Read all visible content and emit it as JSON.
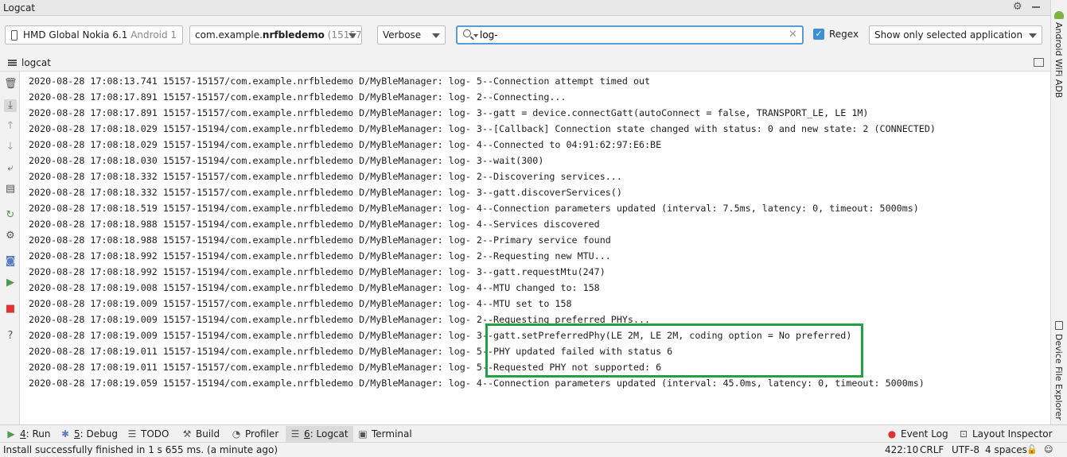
{
  "window": {
    "title": "Logcat"
  },
  "toolbar": {
    "device": {
      "name": "HMD Global Nokia 6.1",
      "os": "Android 1"
    },
    "process": {
      "package_prefix": "com.example.",
      "package_bold": "nrfbledemo",
      "pid": "(15157)"
    },
    "log_level": "Verbose",
    "search": {
      "value": "log-"
    },
    "regex": {
      "label": "Regex",
      "checked": true
    },
    "filter": "Show only selected application"
  },
  "tab": {
    "label": "logcat"
  },
  "log_lines": [
    "2020-08-28 17:08:13.741 15157-15157/com.example.nrfbledemo D/MyBleManager: log- 5--Connection attempt timed out",
    "2020-08-28 17:08:17.891 15157-15157/com.example.nrfbledemo D/MyBleManager: log- 2--Connecting...",
    "2020-08-28 17:08:17.891 15157-15157/com.example.nrfbledemo D/MyBleManager: log- 3--gatt = device.connectGatt(autoConnect = false, TRANSPORT_LE, LE 1M)",
    "2020-08-28 17:08:18.029 15157-15194/com.example.nrfbledemo D/MyBleManager: log- 3--[Callback] Connection state changed with status: 0 and new state: 2 (CONNECTED)",
    "2020-08-28 17:08:18.029 15157-15194/com.example.nrfbledemo D/MyBleManager: log- 4--Connected to 04:91:62:97:E6:BE",
    "2020-08-28 17:08:18.030 15157-15194/com.example.nrfbledemo D/MyBleManager: log- 3--wait(300)",
    "2020-08-28 17:08:18.332 15157-15157/com.example.nrfbledemo D/MyBleManager: log- 2--Discovering services...",
    "2020-08-28 17:08:18.332 15157-15157/com.example.nrfbledemo D/MyBleManager: log- 3--gatt.discoverServices()",
    "2020-08-28 17:08:18.519 15157-15194/com.example.nrfbledemo D/MyBleManager: log- 4--Connection parameters updated (interval: 7.5ms, latency: 0, timeout: 5000ms)",
    "2020-08-28 17:08:18.988 15157-15194/com.example.nrfbledemo D/MyBleManager: log- 4--Services discovered",
    "2020-08-28 17:08:18.988 15157-15194/com.example.nrfbledemo D/MyBleManager: log- 2--Primary service found",
    "2020-08-28 17:08:18.992 15157-15194/com.example.nrfbledemo D/MyBleManager: log- 2--Requesting new MTU...",
    "2020-08-28 17:08:18.992 15157-15194/com.example.nrfbledemo D/MyBleManager: log- 3--gatt.requestMtu(247)",
    "2020-08-28 17:08:19.008 15157-15194/com.example.nrfbledemo D/MyBleManager: log- 4--MTU changed to: 158",
    "2020-08-28 17:08:19.009 15157-15157/com.example.nrfbledemo D/MyBleManager: log- 4--MTU set to 158",
    "2020-08-28 17:08:19.009 15157-15194/com.example.nrfbledemo D/MyBleManager: log- 2--Requesting preferred PHYs...",
    "2020-08-28 17:08:19.009 15157-15194/com.example.nrfbledemo D/MyBleManager: log- 3--gatt.setPreferredPhy(LE 2M, LE 2M, coding option = No preferred)",
    "2020-08-28 17:08:19.011 15157-15194/com.example.nrfbledemo D/MyBleManager: log- 5--PHY updated failed with status 6",
    "2020-08-28 17:08:19.011 15157-15157/com.example.nrfbledemo D/MyBleManager: log- 5--Requested PHY not supported: 6",
    "2020-08-28 17:08:19.059 15157-15194/com.example.nrfbledemo D/MyBleManager: log- 4--Connection parameters updated (interval: 45.0ms, latency: 0, timeout: 5000ms)"
  ],
  "right_sidebar": {
    "top": "Android WiFi ADB",
    "bottom": "Device File Explorer"
  },
  "tool_windows": {
    "run": {
      "mnemonic": "4",
      "label": ": Run"
    },
    "debug": {
      "mnemonic": "5",
      "label": ": Debug"
    },
    "todo": "TODO",
    "build": "Build",
    "profiler": "Profiler",
    "logcat": {
      "mnemonic": "6",
      "label": ": Logcat"
    },
    "terminal": "Terminal",
    "event_log": "Event Log",
    "layout_inspector": "Layout Inspector"
  },
  "status": {
    "message": "Install successfully finished in 1 s 655 ms. (a minute ago)",
    "position": "422:10",
    "line_sep": "CRLF",
    "encoding": "UTF-8",
    "indent": "4 spaces"
  },
  "colors": {
    "highlight_box": "#22a042",
    "search_focus": "#5a9ad5",
    "checkbox": "#3d8fd8"
  }
}
